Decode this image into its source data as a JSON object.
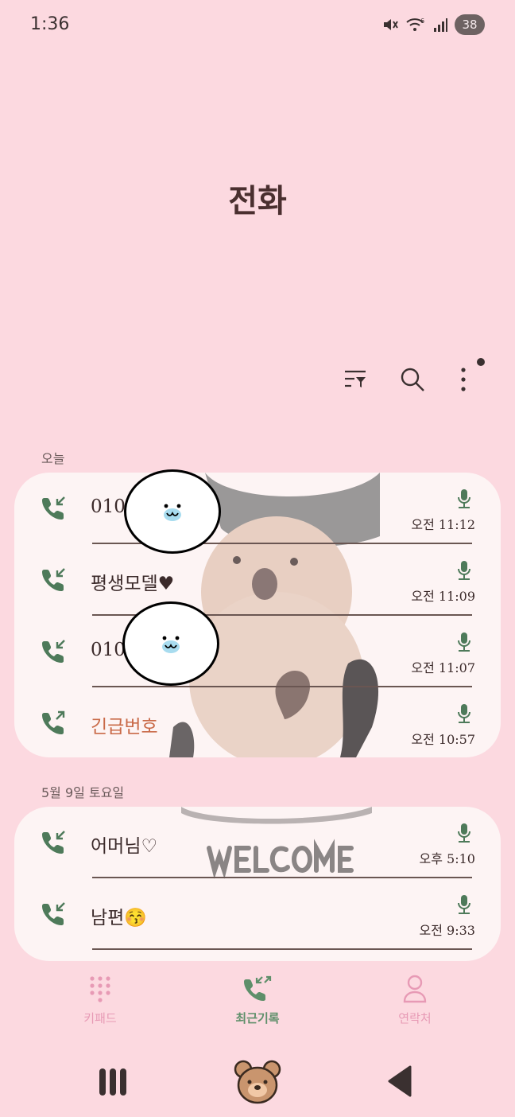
{
  "status_bar": {
    "time": "1:36",
    "battery": "38",
    "icons": [
      "mute-icon",
      "wifi-icon",
      "signal-icon",
      "battery-icon"
    ]
  },
  "header": {
    "title": "전화"
  },
  "toolbar": {
    "icons": [
      "filter-icon",
      "search-icon",
      "more-options-icon"
    ]
  },
  "sections": [
    {
      "label": "오늘",
      "calls": [
        {
          "name": "010-",
          "time": "오전 11:12",
          "type": "incoming"
        },
        {
          "name": "평생모델♥",
          "time": "오전 11:09",
          "type": "incoming"
        },
        {
          "name": "010-",
          "time": "오전 11:07",
          "type": "incoming"
        },
        {
          "name": "긴급번호",
          "time": "오전 10:57",
          "type": "outgoing"
        }
      ]
    },
    {
      "label": "5월 9일 토요일",
      "calls": [
        {
          "name": "어머님♡",
          "time": "오후 5:10",
          "type": "incoming"
        },
        {
          "name": "남편😚",
          "time": "오전 9:33",
          "type": "incoming"
        }
      ]
    }
  ],
  "bottom_nav": {
    "keypad": "키패드",
    "recents": "최근기록",
    "contacts": "연락처"
  },
  "colors": {
    "background": "#fcd9e0",
    "card": "#fdf4f4",
    "call_icon": "#4e7a5a",
    "emergency": "#c96a48",
    "nav_active": "#5e8f6a",
    "nav_inactive": "#e79ab5"
  }
}
